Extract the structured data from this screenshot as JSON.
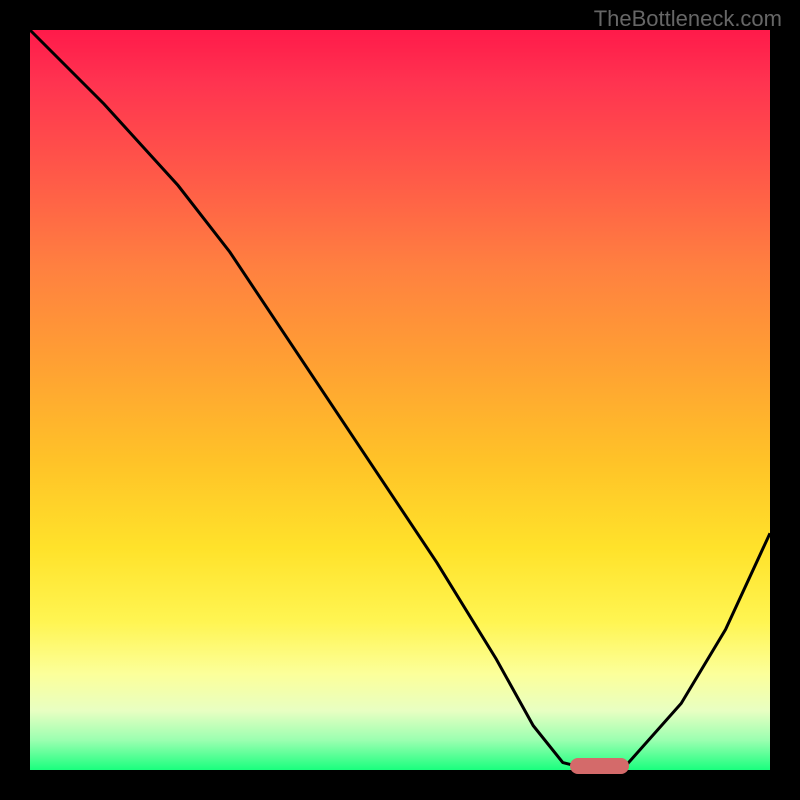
{
  "watermark": "TheBottleneck.com",
  "chart_data": {
    "type": "line",
    "title": "",
    "xlabel": "",
    "ylabel": "",
    "xlim": [
      0,
      100
    ],
    "ylim": [
      0,
      100
    ],
    "grid": false,
    "series": [
      {
        "name": "bottleneck-curve",
        "x": [
          0,
          10,
          20,
          27,
          35,
          45,
          55,
          63,
          68,
          72,
          76,
          80,
          88,
          94,
          100
        ],
        "values": [
          100,
          90,
          79,
          70,
          58,
          43,
          28,
          15,
          6,
          1,
          0,
          0,
          9,
          19,
          32
        ]
      }
    ],
    "marker": {
      "x_start": 73,
      "x_end": 81,
      "y": 0.5
    },
    "colors": {
      "gradient_top": "#ff1a4a",
      "gradient_mid": "#ffcf2a",
      "gradient_bottom": "#1aff7e",
      "curve": "#000000",
      "marker": "#d46a6a",
      "frame": "#000000"
    }
  }
}
